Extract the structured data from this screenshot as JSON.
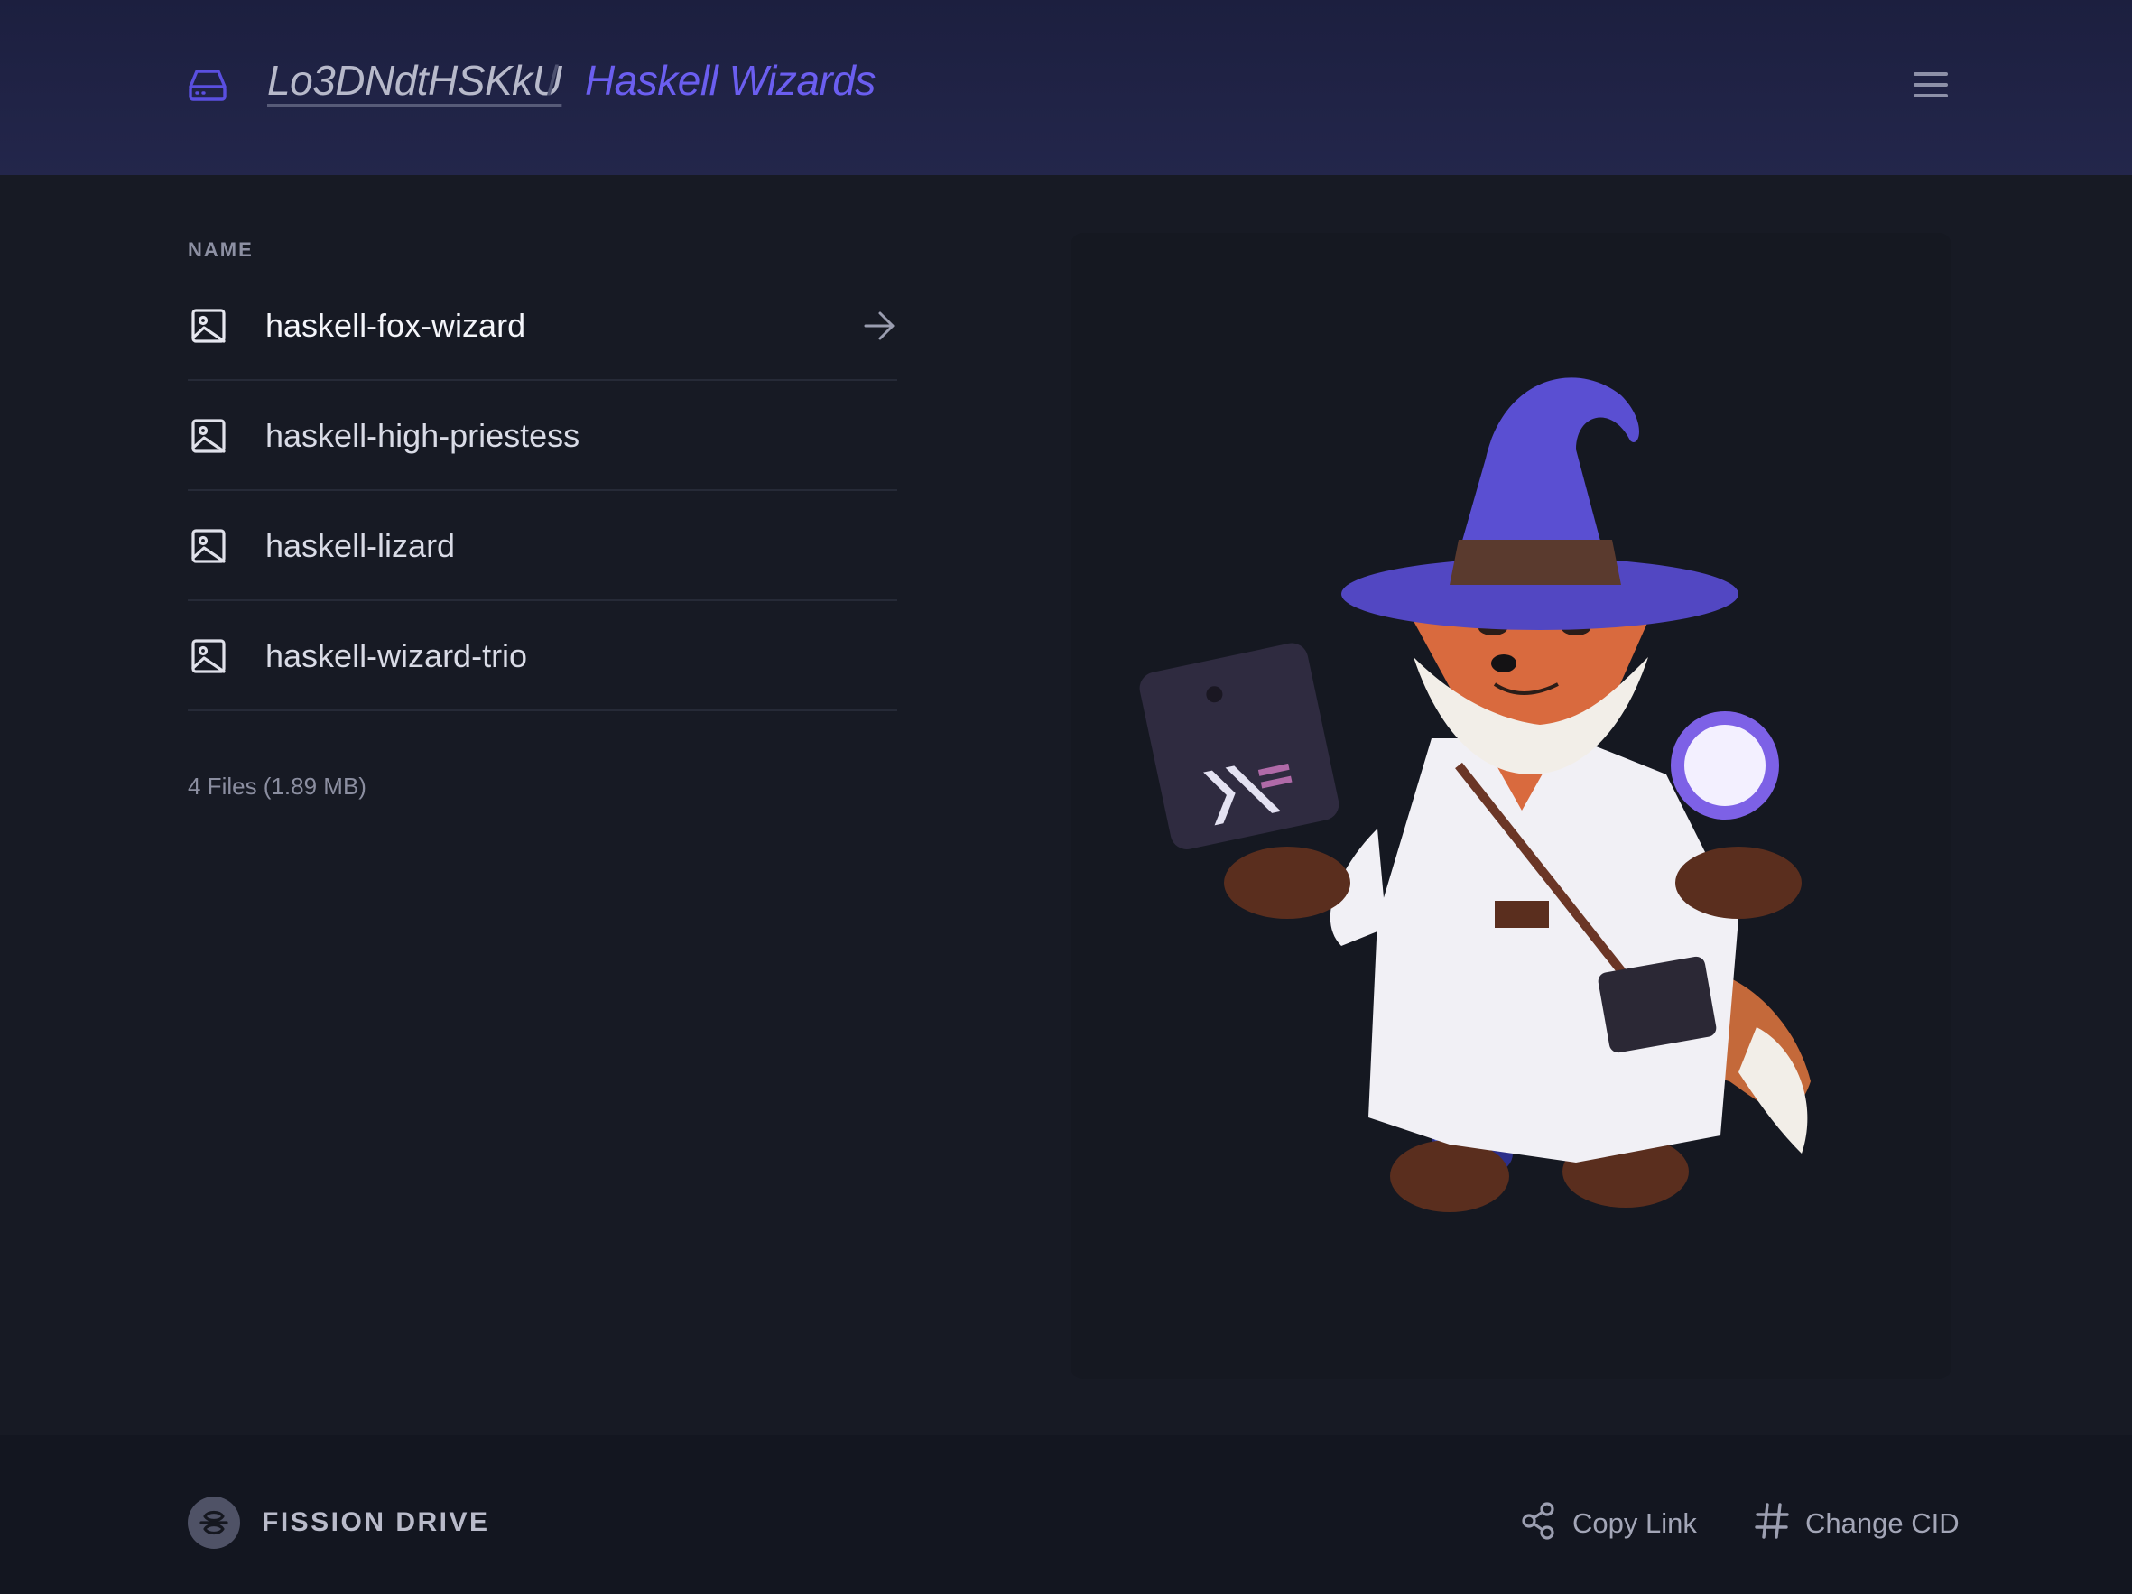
{
  "header": {
    "drive_icon": "drive-icon",
    "breadcrumb": {
      "root": "Lo3DNdtHSKkU",
      "separator": "/",
      "current": "Haskell Wizards"
    },
    "menu_icon": "hamburger-menu-icon"
  },
  "file_list": {
    "column_header": "NAME",
    "files": [
      {
        "name": "haskell-fox-wizard",
        "icon": "image-file-icon",
        "selected": true
      },
      {
        "name": "haskell-high-priestess",
        "icon": "image-file-icon",
        "selected": false
      },
      {
        "name": "haskell-lizard",
        "icon": "image-file-icon",
        "selected": false
      },
      {
        "name": "haskell-wizard-trio",
        "icon": "image-file-icon",
        "selected": false
      }
    ],
    "summary": "4 Files (1.89 MB)"
  },
  "preview": {
    "image_of": "haskell-fox-wizard"
  },
  "footer": {
    "brand": "FISSION DRIVE",
    "actions": {
      "copy_link": "Copy Link",
      "change_cid": "Change CID"
    }
  },
  "colors": {
    "header_bg": "#1f2244",
    "page_bg": "#171a24",
    "accent": "#6b5ef0",
    "text_primary": "#d9dbe6",
    "text_muted": "#8d90a3"
  }
}
